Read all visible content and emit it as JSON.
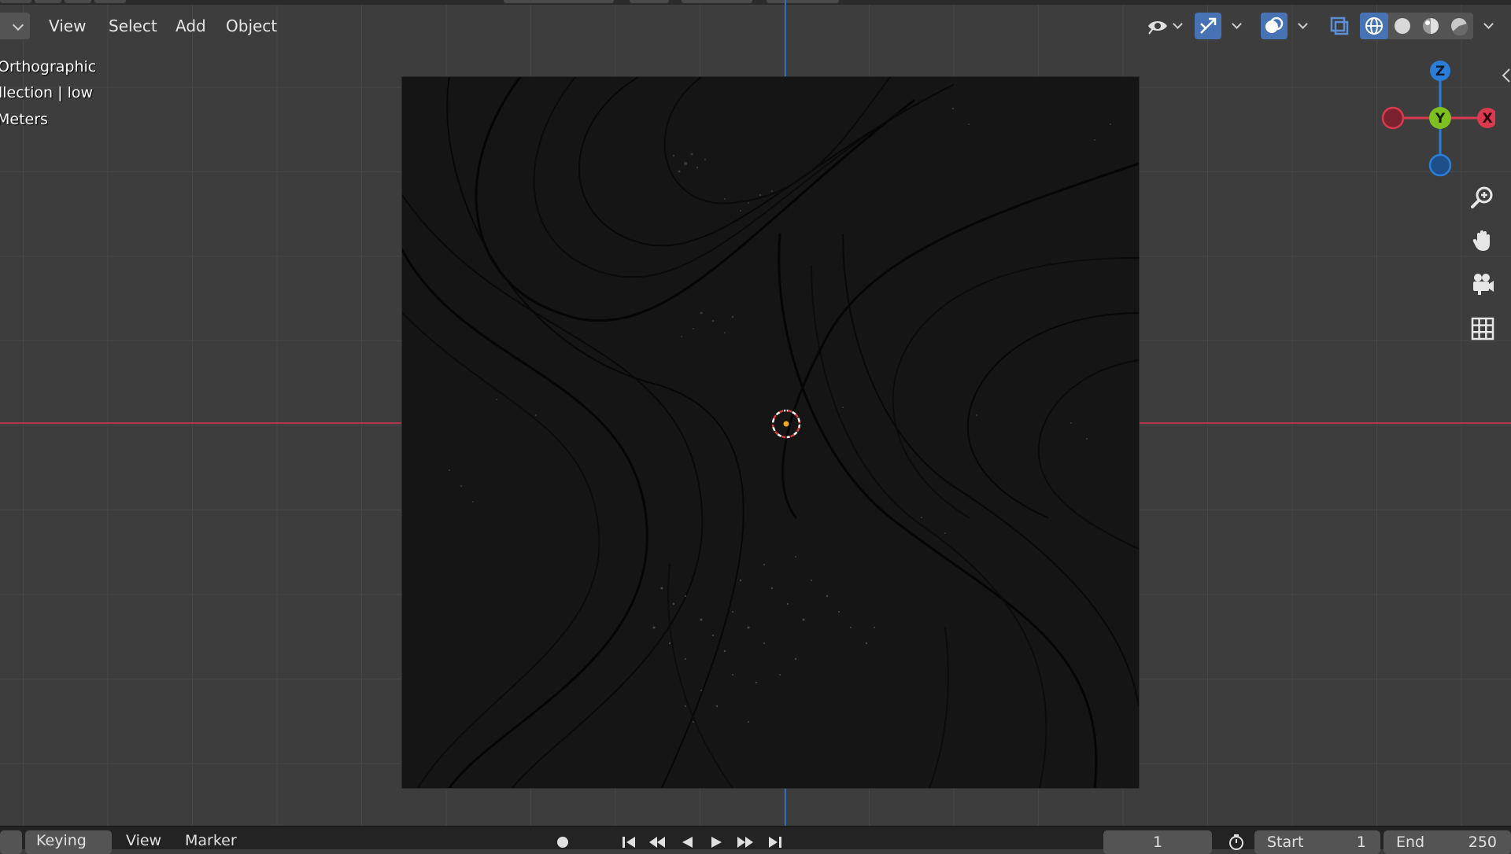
{
  "header": {
    "menu": {
      "view": "View",
      "select": "Select",
      "add": "Add",
      "object": "Object"
    },
    "icons": [
      "eye-visibility-icon",
      "gizmo-icon",
      "overlays-icon",
      "xray-icon",
      "wireframe-shading-icon",
      "solid-shading-icon",
      "material-preview-icon",
      "rendered-shading-icon"
    ]
  },
  "viewport_info": {
    "view_name": "Orthographic",
    "collection": "llection | low",
    "units": "Meters"
  },
  "gizmo": {
    "z_label": "Z",
    "y_label": "Y",
    "x_label": "X",
    "colors": {
      "x": "#d93a4f",
      "y": "#7fbf22",
      "z": "#2a7ed8"
    }
  },
  "nav_tools": [
    "zoom-icon",
    "hand-pan-icon",
    "camera-icon",
    "grid-ortho-icon"
  ],
  "timeline": {
    "keying_label": "Keying",
    "view_label": "View",
    "marker_label": "Marker",
    "current_frame": "1",
    "start_label": "Start",
    "start_value": "1",
    "end_label": "End",
    "end_value": "250"
  },
  "colors": {
    "accent": "#4772b3",
    "x_axis": "#b0384e",
    "y_axis": "#2d6fc4",
    "cursor_center": "#f5a623"
  }
}
